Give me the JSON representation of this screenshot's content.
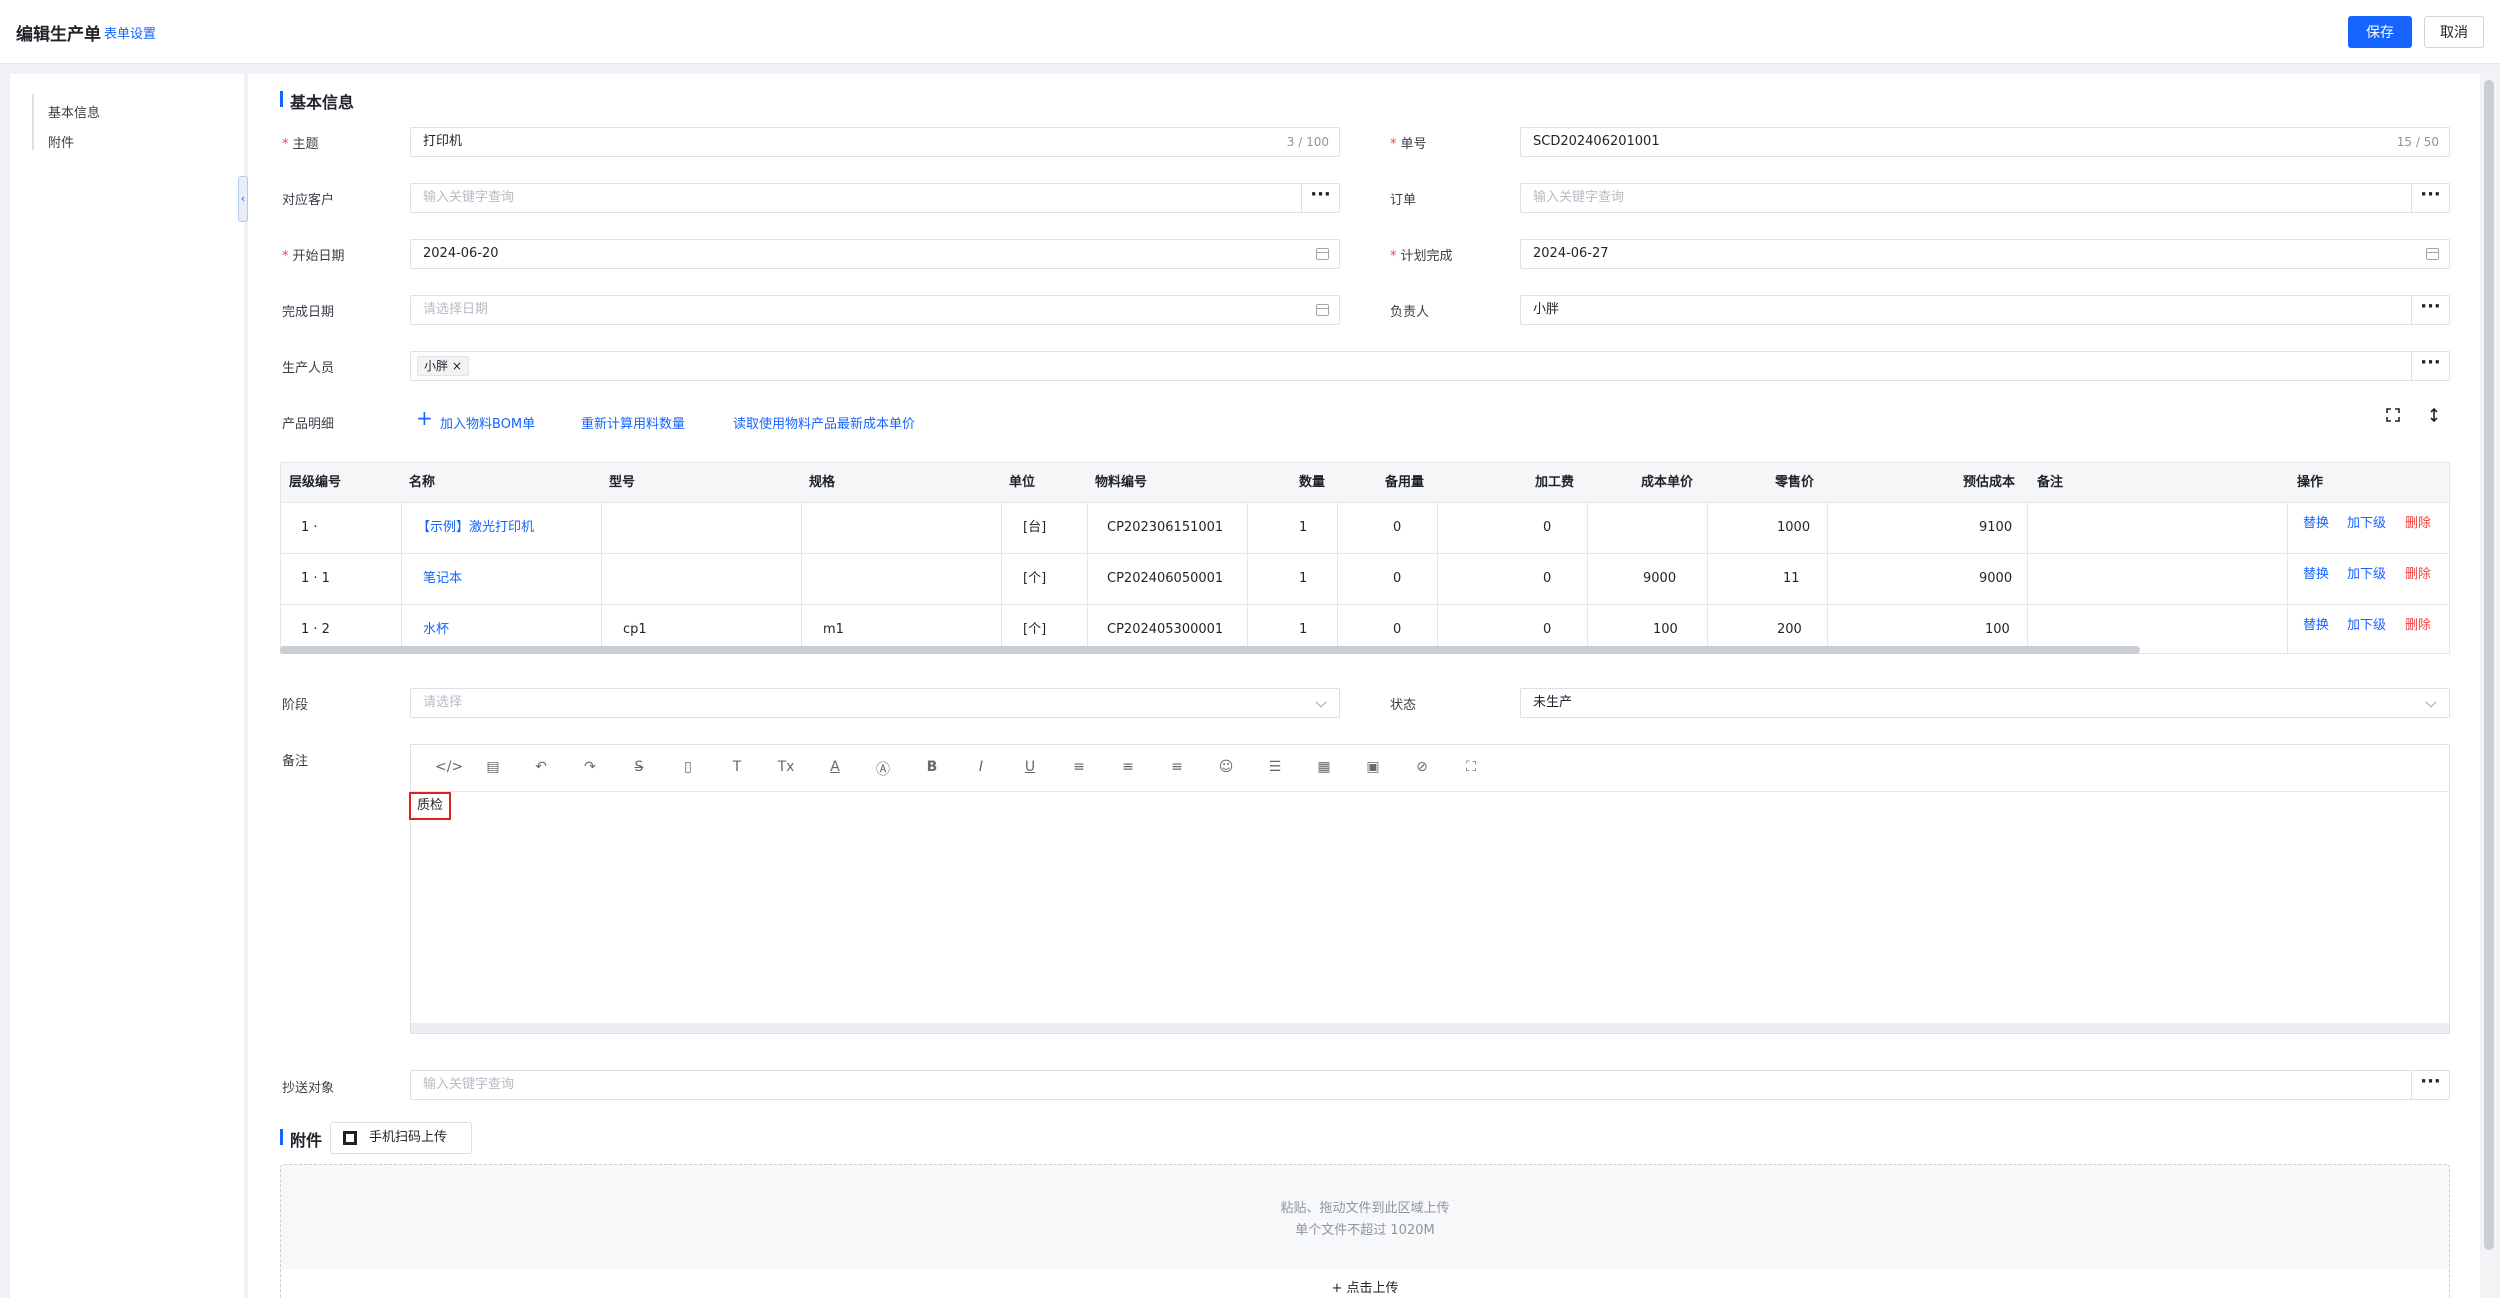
{
  "header": {
    "title": "编辑生产单",
    "form_settings": "表单设置",
    "save": "保存",
    "cancel": "取消"
  },
  "sidebar": {
    "items": [
      {
        "label": "基本信息"
      },
      {
        "label": "附件"
      }
    ]
  },
  "basic_section": {
    "title": "基本信息"
  },
  "form": {
    "subject": {
      "label": "主题",
      "value": "打印机",
      "counter": "3 / 100"
    },
    "number": {
      "label": "单号",
      "value": "SCD202406201001",
      "counter": "15 / 50"
    },
    "customer": {
      "label": "对应客户",
      "placeholder": "输入关键字查询"
    },
    "order": {
      "label": "订单",
      "placeholder": "输入关键字查询"
    },
    "start_date": {
      "label": "开始日期",
      "value": "2024-06-20"
    },
    "plan_done": {
      "label": "计划完成",
      "value": "2024-06-27"
    },
    "finish_date": {
      "label": "完成日期",
      "placeholder": "请选择日期"
    },
    "owner": {
      "label": "负责人",
      "value": "小胖"
    },
    "workers": {
      "label": "生产人员",
      "tag": "小胖",
      "tag_close": "×"
    },
    "products": {
      "label": "产品明细",
      "add_bom": "加入物料BOM单",
      "recalc": "重新计算用料数量",
      "read_cost": "读取使用物料产品最新成本单价"
    },
    "stage": {
      "label": "阶段",
      "placeholder": "请选择"
    },
    "status": {
      "label": "状态",
      "value": "未生产"
    },
    "remark": {
      "label": "备注",
      "content": "质检"
    },
    "cc": {
      "label": "抄送对象",
      "placeholder": "输入关键字查询"
    }
  },
  "table": {
    "headers": [
      "层级编号",
      "名称",
      "型号",
      "规格",
      "单位",
      "物料编号",
      "数量",
      "备用量",
      "加工费",
      "成本单价",
      "零售价",
      "预估成本",
      "备注",
      "操作"
    ],
    "rows": [
      {
        "level": "1 ·",
        "name": "【示例】激光打印机",
        "model": "",
        "spec": "",
        "unit": "[台]",
        "code": "CP202306151001",
        "qty": "1",
        "spare": "0",
        "fee": "0",
        "cost": "",
        "retail": "1000",
        "est": "9100",
        "note": ""
      },
      {
        "level": "1 · 1",
        "name": "笔记本",
        "model": "",
        "spec": "",
        "unit": "[个]",
        "code": "CP202406050001",
        "qty": "1",
        "spare": "0",
        "fee": "0",
        "cost": "9000",
        "retail": "11",
        "est": "9000",
        "note": ""
      },
      {
        "level": "1 · 2",
        "name": "水杯",
        "model": "cp1",
        "spec": "m1",
        "unit": "[个]",
        "code": "CP202405300001",
        "qty": "1",
        "spare": "0",
        "fee": "0",
        "cost": "100",
        "retail": "200",
        "est": "100",
        "note": ""
      }
    ],
    "actions": {
      "replace": "替换",
      "add_child": "加下级",
      "delete": "删除"
    }
  },
  "attach": {
    "title": "附件",
    "qr_upload": "手机扫码上传",
    "drop_line1": "粘贴、拖动文件到此区域上传",
    "drop_line2": "单个文件不超过 1020M",
    "click_upload": "+ 点击上传"
  },
  "colors": {
    "accent": "#1664ff",
    "danger": "#f53f3f",
    "required": "#f53f3f",
    "highlight_border": "#e02020"
  }
}
